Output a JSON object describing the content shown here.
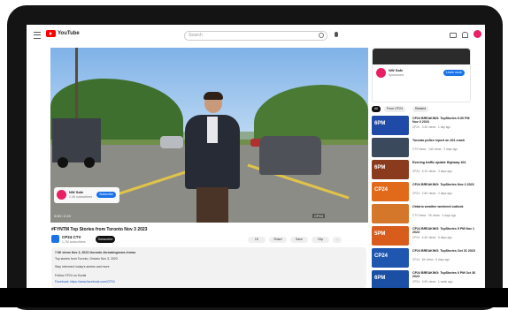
{
  "header": {
    "logo_text": "YouTube",
    "search_placeholder": "Search"
  },
  "video": {
    "title": "#FYNTM Top Stories from Toronto Nov 3 2023",
    "time_display": "0:00 / 2:10",
    "watermark": "CP24",
    "overlay_channel": "NW Safe",
    "overlay_sub": "2.4K subscribers",
    "overlay_button": "Subscribe"
  },
  "channel": {
    "name": "CP24 CTV",
    "subs": "1.7M subscribers",
    "subscribe_label": "Subscribe"
  },
  "actions": {
    "like": "1K",
    "share": "Share",
    "save": "Save",
    "clip": "Clip",
    "more": "..."
  },
  "description": {
    "lines": [
      "7.6K views  Nov 3, 2023  #toronto #breakingnews #news",
      "Top stories from Toronto, Ontario Nov 3, 2023",
      "Stay informed: today's stories and more",
      "Follow CP24 on Social",
      "Facebook: https://www.facebook.com/CP24"
    ]
  },
  "sidebar": {
    "ad": {
      "name": "NW Safe",
      "sub": "Sponsored",
      "button": "Learn more"
    },
    "chips": [
      "All",
      "From CP24",
      "Related"
    ],
    "recommendations": [
      {
        "thumb_label": "6PM",
        "thumb_color": "#1f4aa8",
        "title": "CP24 BREAKING: TopStories 6:30 PM Nov 3 2023",
        "meta": "CP24 · 3.2K views · 1 day ago"
      },
      {
        "thumb_label": "",
        "thumb_color": "#3a4a5c",
        "title": "Toronto police report on 401 crash",
        "meta": "CTV News · 14K views · 2 days ago"
      },
      {
        "thumb_label": "6PM",
        "thumb_color": "#8a3b1e",
        "title": "Evening traffic update Highway 401",
        "meta": "CP24 · 5.1K views · 3 days ago"
      },
      {
        "thumb_label": "CP24",
        "thumb_color": "#e06a1a",
        "title": "CP24 BREAKING: TopStories Nov 2 2023",
        "meta": "CP24 · 2.8K views · 2 days ago"
      },
      {
        "thumb_label": "",
        "thumb_color": "#d4772a",
        "title": "Ontario weather weekend outlook",
        "meta": "CTV News · 9K views · 4 days ago"
      },
      {
        "thumb_label": "5PM",
        "thumb_color": "#d85d1d",
        "title": "CP24 BREAKING: TopStories 5 PM Nov 1 2023",
        "meta": "CP24 · 4.4K views · 5 days ago"
      },
      {
        "thumb_label": "CP24",
        "thumb_color": "#1e56b0",
        "title": "CP24 BREAKING: TopStories Oct 31 2023",
        "meta": "CP24 · 6K views · 6 days ago"
      },
      {
        "thumb_label": "6PM",
        "thumb_color": "#1a4fa3",
        "title": "CP24 BREAKING: TopStories 6 PM Oct 30 2023",
        "meta": "CP24 · 3.9K views · 1 week ago"
      }
    ]
  }
}
